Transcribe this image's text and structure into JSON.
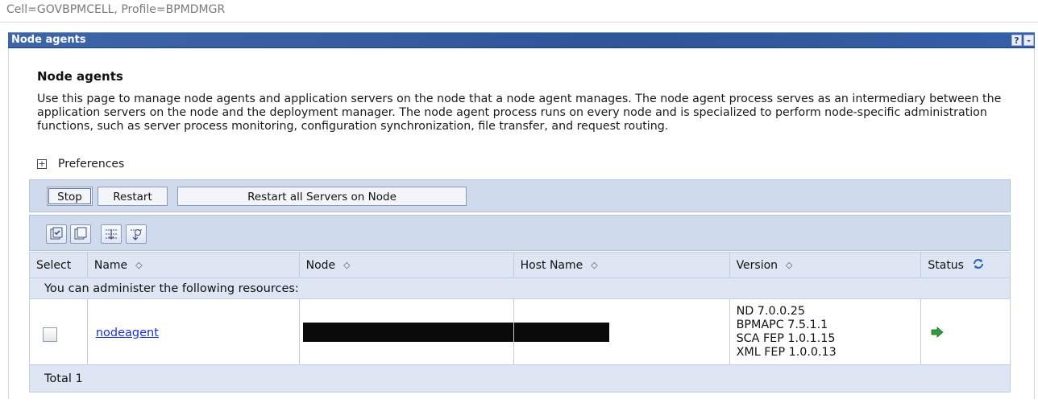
{
  "breadcrumb": "Cell=GOVBPMCELL, Profile=BPMDMGR",
  "panel": {
    "title": "Node agents",
    "help_label": "?",
    "minimize_label": "-"
  },
  "section_title": "Node agents",
  "description": "Use this page to manage node agents and application servers on the node that a node agent manages. The node agent process serves as an intermediary between the application servers on the node and the deployment manager. The node agent process runs on every node and is specialized to perform node-specific administration functions, such as server process monitoring, configuration synchronization, file transfer, and request routing.",
  "preferences": {
    "expand_symbol": "+",
    "label": "Preferences"
  },
  "actions": {
    "stop": "Stop",
    "restart": "Restart",
    "restart_all": "Restart all Servers on Node"
  },
  "table": {
    "headers": {
      "select": "Select",
      "name": "Name",
      "node": "Node",
      "host": "Host Name",
      "version": "Version",
      "status": "Status"
    },
    "resources_label": "You can administer the following resources:",
    "rows": [
      {
        "name": "nodeagent",
        "versions": [
          "ND 7.0.0.25",
          "BPMAPC 7.5.1.1",
          "SCA FEP 1.0.1.15",
          "XML FEP 1.0.0.13"
        ],
        "status_icon": "started-arrow-icon"
      }
    ],
    "total": "Total 1"
  },
  "colors": {
    "header_blue": "#2e5598",
    "row_background": "#dfe6f3",
    "link": "#1b2fd6",
    "highlight": "#f4f21a",
    "status_green": "#2e9d3a"
  }
}
